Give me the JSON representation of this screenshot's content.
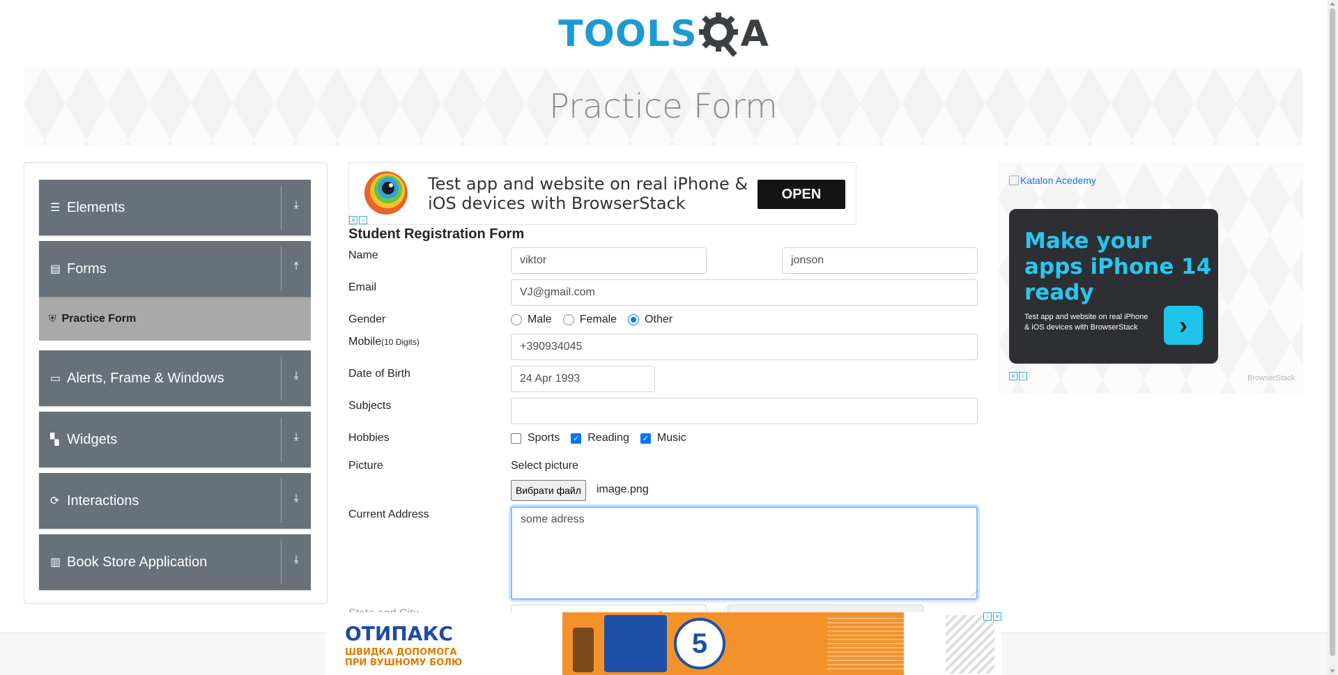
{
  "header": {
    "logo_primary": "TOOLS",
    "logo_secondary": "A",
    "page_title": "Practice Form"
  },
  "sidebar": {
    "groups": [
      {
        "label": "Elements",
        "icon": "hamburger-icon",
        "arrow": "download-icon"
      },
      {
        "label": "Forms",
        "icon": "document-icon",
        "arrow": "upload-icon",
        "expanded": true,
        "items": [
          {
            "label": "Practice Form",
            "icon": "html5-icon"
          }
        ]
      },
      {
        "label": "Alerts, Frame & Windows",
        "icon": "window-icon",
        "arrow": "download-icon"
      },
      {
        "label": "Widgets",
        "icon": "widgets-icon",
        "arrow": "download-icon"
      },
      {
        "label": "Interactions",
        "icon": "interaction-icon",
        "arrow": "download-icon"
      },
      {
        "label": "Book Store Application",
        "icon": "book-icon",
        "arrow": "download-icon"
      }
    ]
  },
  "ad_top": {
    "text_line1": "Test app and website on real iPhone &",
    "text_line2": "iOS devices with BrowserStack",
    "button": "OPEN"
  },
  "form": {
    "title": "Student Registration Form",
    "name_label": "Name",
    "first_name": "viktor",
    "last_name": "jonson",
    "email_label": "Email",
    "email": "VJ@gmail.com",
    "gender_label": "Gender",
    "genders": [
      {
        "label": "Male",
        "checked": false
      },
      {
        "label": "Female",
        "checked": false
      },
      {
        "label": "Other",
        "checked": true
      }
    ],
    "mobile_label": "Mobile",
    "mobile_hint": "(10 Digits)",
    "mobile": "+390934045",
    "dob_label": "Date of Birth",
    "dob": "24 Apr 1993",
    "subjects_label": "Subjects",
    "subjects": "",
    "hobbies_label": "Hobbies",
    "hobbies": [
      {
        "label": "Sports",
        "checked": false
      },
      {
        "label": "Reading",
        "checked": true
      },
      {
        "label": "Music",
        "checked": true
      }
    ],
    "picture_label": "Picture",
    "picture_select": "Select picture",
    "file_button": "Вибрати файл",
    "file_name": "image.png",
    "address_label": "Current Address",
    "address": "some adress",
    "state_city_label": "State and City"
  },
  "ad_right": {
    "alt_text": "Katalon Acedemy",
    "headline": "Make your apps iPhone 14 ready",
    "sub": "Test app and website on real iPhone & iOS devices with BrowserStack",
    "brand": "BrowserStack"
  },
  "ad_bottom": {
    "brand": "ОТИПАКС",
    "tag_line1": "ШВИДКА ДОПОМОГА",
    "tag_line2": "ПРИ ВУШНОМУ БОЛЮ",
    "badge": "5"
  },
  "colors": {
    "sidebar_header": "#687079",
    "sidebar_active": "#a9a9a9",
    "accent": "#0075ff",
    "logo_blue": "#1b9ad6"
  }
}
